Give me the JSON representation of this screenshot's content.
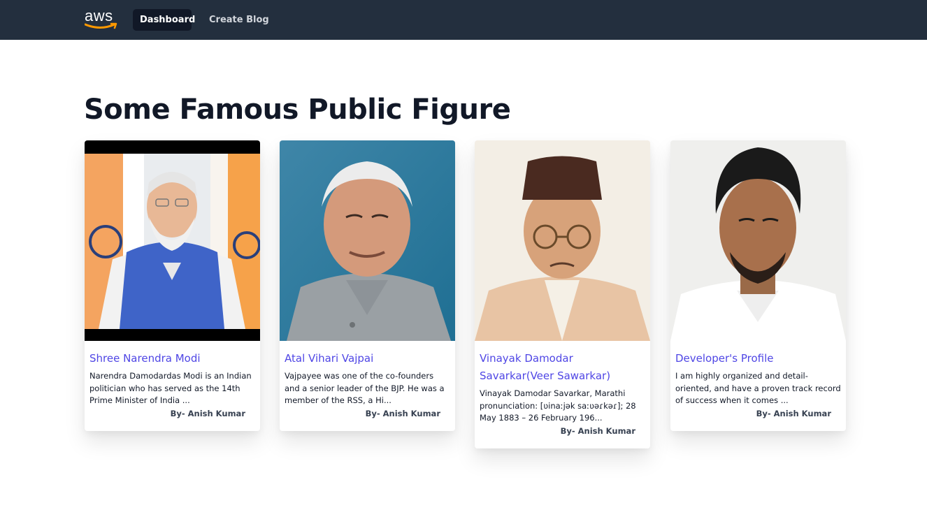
{
  "nav": {
    "logo_text": "aws",
    "links": [
      {
        "label": "Dashboard",
        "active": true
      },
      {
        "label": "Create Blog",
        "active": false
      }
    ],
    "background": "#232f3e",
    "logo_smile_color": "#ff9900"
  },
  "page": {
    "title": "Some Famous Public Figure"
  },
  "cards": [
    {
      "title": "Shree Narendra Modi",
      "excerpt": "Narendra Damodardas Modi is an Indian politician who has served as the 14th Prime Minister of India ...",
      "author": "By- Anish Kumar",
      "image": "portrait-photo"
    },
    {
      "title": "Atal Vihari Vajpai",
      "excerpt": "Vajpayee was one of the co-founders and a senior leader of the BJP. He was a member of the RSS, a Hi...",
      "author": "By- Anish Kumar",
      "image": "portrait-photo"
    },
    {
      "title": "Vinayak Damodar Savarkar(Veer Sawarkar)",
      "excerpt": "Vinayak Damodar Savarkar, Marathi pronunciation: [ʋinaːjək saːʋəɾkəɾ]; 28 May 1883 – 26 February 196...",
      "author": "By- Anish Kumar",
      "image": "portrait-painting"
    },
    {
      "title": "Developer's Profile",
      "excerpt": "I am highly organized and detail-oriented, and have a proven track record of success when it comes ...",
      "author": "By- Anish Kumar",
      "image": "portrait-photo"
    }
  ],
  "colors": {
    "link": "#4f46e5",
    "heading": "#111827"
  }
}
